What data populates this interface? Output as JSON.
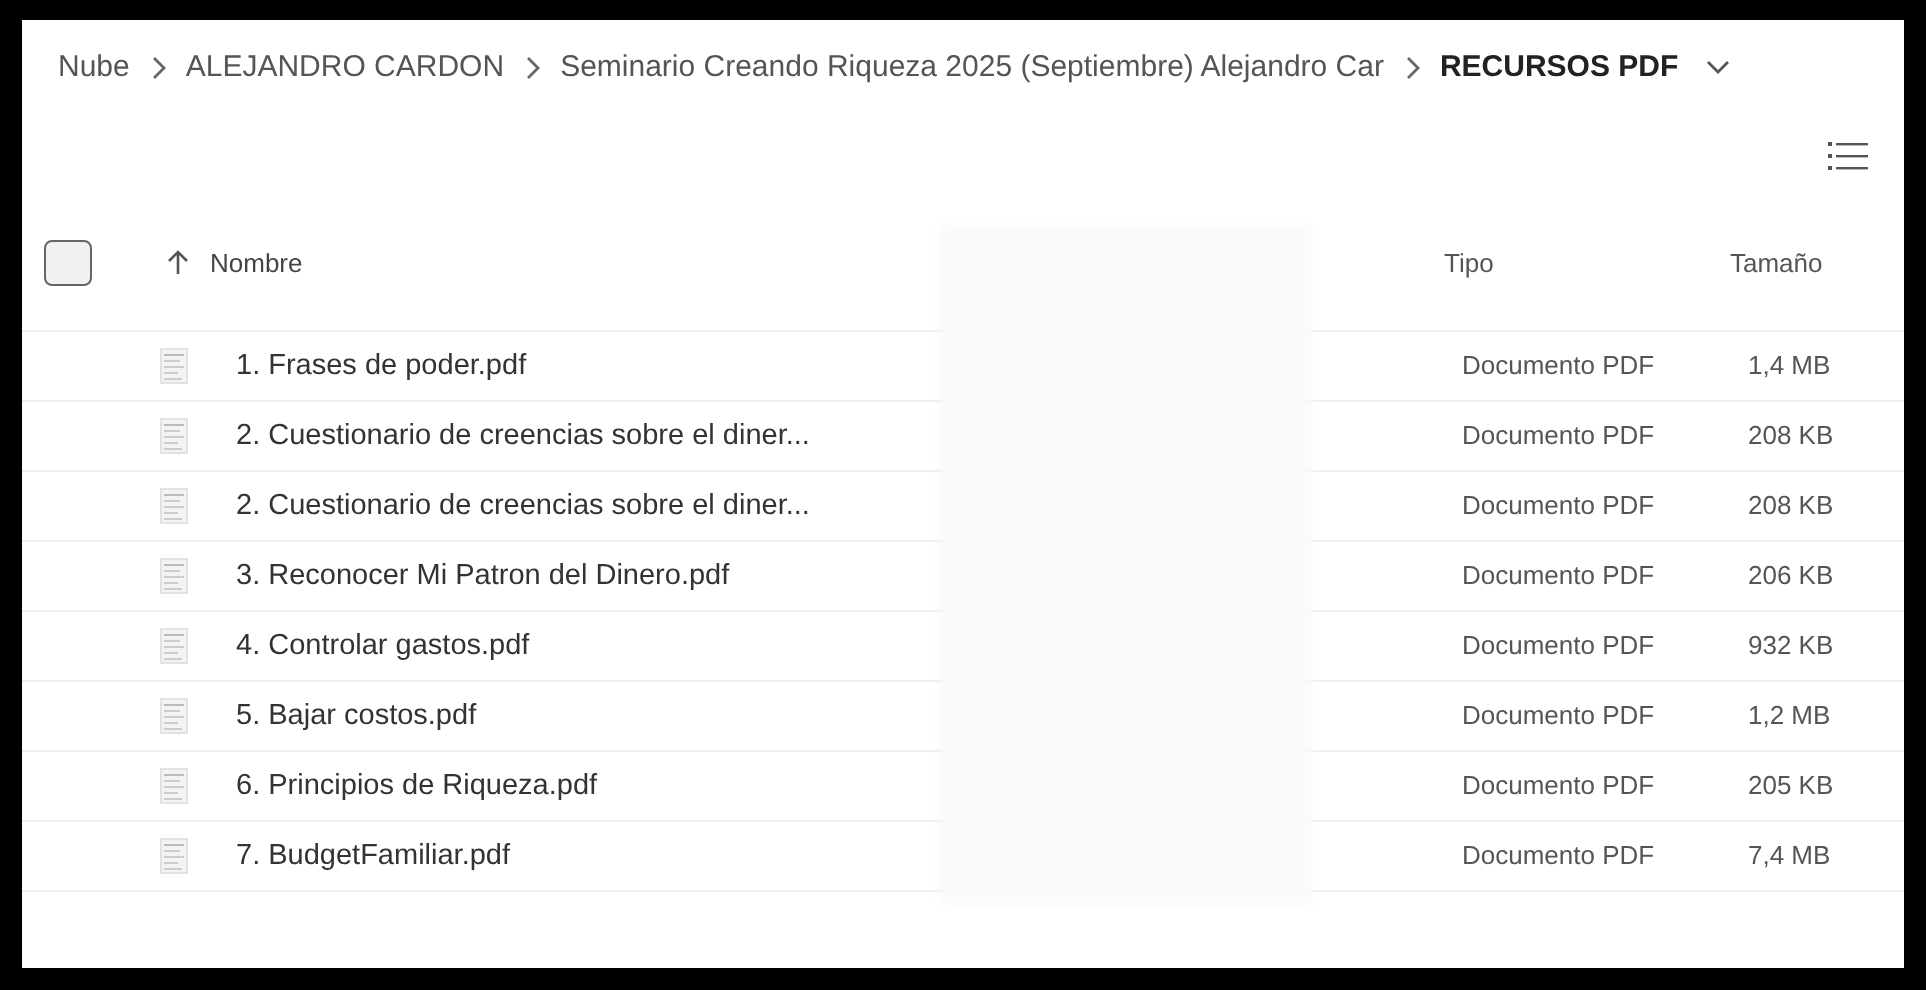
{
  "breadcrumb": [
    {
      "label": "Nube",
      "current": false
    },
    {
      "label": "ALEJANDRO CARDON",
      "current": false
    },
    {
      "label": "Seminario Creando Riqueza 2025 (Septiembre) Alejandro Car",
      "current": false
    },
    {
      "label": "RECURSOS PDF",
      "current": true
    }
  ],
  "table": {
    "select_all": {
      "checked": false
    },
    "columns": [
      {
        "label": "Nombre",
        "sorted": true
      },
      {
        "label": "Tipo",
        "sorted": false
      },
      {
        "label": "Tamaño",
        "sorted": false
      }
    ],
    "rows": [
      {
        "name": "1. Frases de poder.pdf",
        "type": "Documento PDF",
        "size": "1,4 MB"
      },
      {
        "name": "2. Cuestionario de creencias sobre el diner...",
        "type": "Documento PDF",
        "size": "208 KB"
      },
      {
        "name": "2. Cuestionario de creencias sobre el diner...",
        "type": "Documento PDF",
        "size": "208 KB"
      },
      {
        "name": "3. Reconocer Mi Patron del Dinero.pdf",
        "type": "Documento PDF",
        "size": "206 KB"
      },
      {
        "name": "4. Controlar gastos.pdf",
        "type": "Documento PDF",
        "size": "932 KB"
      },
      {
        "name": "5. Bajar costos.pdf",
        "type": "Documento PDF",
        "size": "1,2 MB"
      },
      {
        "name": "6. Principios de Riqueza.pdf",
        "type": "Documento PDF",
        "size": "205 KB"
      },
      {
        "name": "7. BudgetFamiliar.pdf",
        "type": "Documento PDF",
        "size": "7,4 MB"
      }
    ]
  }
}
